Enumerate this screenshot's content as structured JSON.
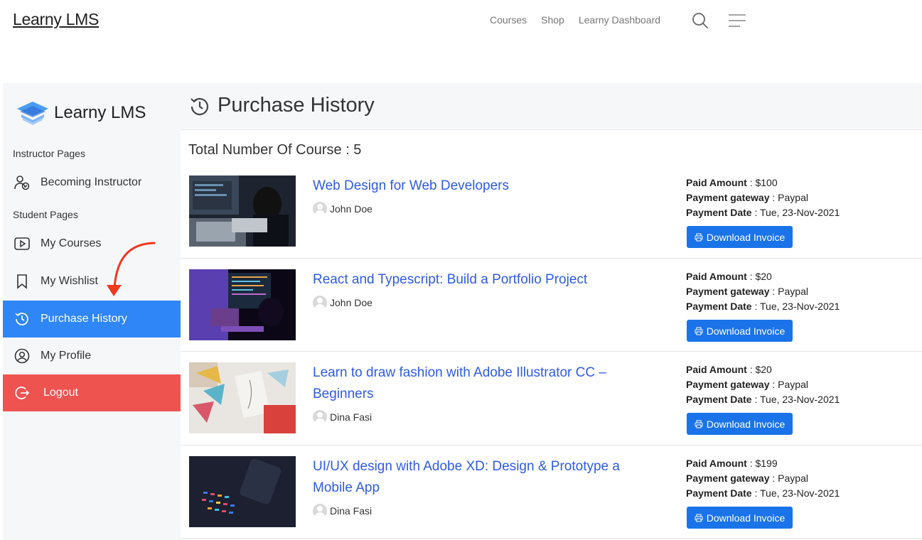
{
  "header": {
    "brand": "Learny LMS",
    "nav": [
      "Courses",
      "Shop",
      "Learny Dashboard"
    ],
    "search_icon": "search-icon",
    "menu_icon": "hamburger-icon"
  },
  "sidebar": {
    "logo_text": "Learny LMS",
    "section_instructor": "Instructor Pages",
    "section_student": "Student Pages",
    "items": [
      {
        "label": "Becoming Instructor",
        "icon": "user-check-icon"
      },
      {
        "label": "My Courses",
        "icon": "play-icon"
      },
      {
        "label": "My Wishlist",
        "icon": "bookmark-icon"
      },
      {
        "label": "Purchase History",
        "icon": "history-icon",
        "active": true
      },
      {
        "label": "My Profile",
        "icon": "user-circle-icon"
      },
      {
        "label": "Logout",
        "icon": "logout-icon"
      }
    ],
    "active_color": "#2f86f6",
    "logout_color": "#ef5350"
  },
  "main": {
    "title": "Purchase History",
    "total": "Total Number Of Course : 5",
    "labels": {
      "paid_amount": "Paid Amount",
      "gateway": "Payment gateway",
      "date": "Payment Date",
      "download": "Download Invoice"
    },
    "purchases": [
      {
        "title": "Web Design for Web Developers",
        "author": "John Doe",
        "amount": " : $100",
        "gateway": " : Paypal",
        "date": " : Tue, 23-Nov-2021"
      },
      {
        "title": "React and Typescript: Build a Portfolio Project",
        "author": "John Doe",
        "amount": " : $20",
        "gateway": " : Paypal",
        "date": " : Tue, 23-Nov-2021"
      },
      {
        "title": "Learn to draw fashion with Adobe Illustrator CC – Beginners",
        "author": "Dina Fasi",
        "amount": " : $20",
        "gateway": " : Paypal",
        "date": " : Tue, 23-Nov-2021"
      },
      {
        "title": "UI/UX design with Adobe XD: Design & Prototype a Mobile App",
        "author": "Dina Fasi",
        "amount": " : $199",
        "gateway": " : Paypal",
        "date": " : Tue, 23-Nov-2021"
      }
    ],
    "link_color": "#2f5be6",
    "button_color": "#1a73e8"
  }
}
